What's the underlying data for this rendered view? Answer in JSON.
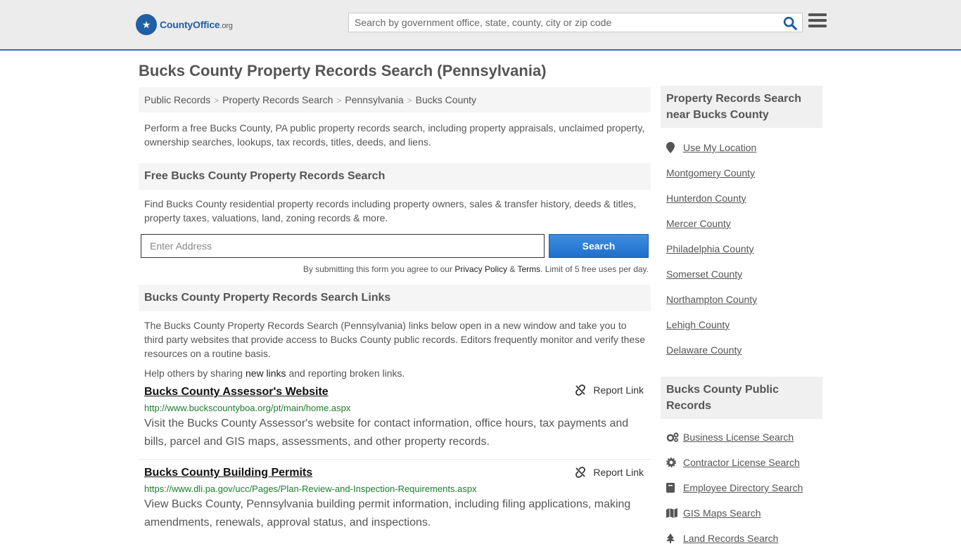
{
  "header": {
    "logo_name": "CountyOffice",
    "logo_tld": ".org",
    "search_placeholder": "Search by government office, state, county, city or zip code"
  },
  "page_title": "Bucks County Property Records Search (Pennsylvania)",
  "breadcrumb": [
    "Public Records",
    "Property Records Search",
    "Pennsylvania",
    "Bucks County"
  ],
  "intro": "Perform a free Bucks County, PA public property records search, including property appraisals, unclaimed property, ownership searches, lookups, tax records, titles, deeds, and liens.",
  "free_search": {
    "heading": "Free Bucks County Property Records Search",
    "text": "Find Bucks County residential property records including property owners, sales & transfer history, deeds & titles, property taxes, valuations, land, zoning records & more.",
    "address_placeholder": "Enter Address",
    "button": "Search",
    "disclaimer_prefix": "By submitting this form you agree to our ",
    "privacy": "Privacy Policy",
    "amp": " & ",
    "terms": "Terms",
    "disclaimer_suffix": ". Limit of 5 free uses per day."
  },
  "links_section": {
    "heading": "Bucks County Property Records Search Links",
    "text": "The Bucks County Property Records Search (Pennsylvania) links below open in a new window and take you to third party websites that provide access to Bucks County public records. Editors frequently monitor and verify these resources on a routine basis.",
    "help_prefix": "Help others by sharing ",
    "help_link": "new links",
    "help_suffix": " and reporting broken links.",
    "report_label": "Report Link",
    "entries": [
      {
        "title": "Bucks County Assessor's Website",
        "url": "http://www.buckscountyboa.org/pt/main/home.aspx",
        "desc": "Visit the Bucks County Assessor's website for contact information, office hours, tax payments and bills, parcel and GIS maps, assessments, and other property records."
      },
      {
        "title": "Bucks County Building Permits",
        "url": "https://www.dli.pa.gov/ucc/Pages/Plan-Review-and-Inspection-Requirements.aspx",
        "desc": "View Bucks County, Pennsylvania building permit information, including filing applications, making amendments, renewals, approval status, and inspections."
      }
    ]
  },
  "sidebar": {
    "nearby_heading": "Property Records Search near Bucks County",
    "use_location": "Use My Location",
    "nearby": [
      "Montgomery County",
      "Hunterdon County",
      "Mercer County",
      "Philadelphia County",
      "Somerset County",
      "Northampton County",
      "Lehigh County",
      "Delaware County"
    ],
    "public_heading": "Bucks County Public Records",
    "public_records": [
      {
        "label": "Business License Search",
        "icon": "gears-icon"
      },
      {
        "label": "Contractor License Search",
        "icon": "gear-icon"
      },
      {
        "label": "Employee Directory Search",
        "icon": "book-icon"
      },
      {
        "label": "GIS Maps Search",
        "icon": "map-icon"
      },
      {
        "label": "Land Records Search",
        "icon": "tree-icon"
      }
    ]
  },
  "colors": {
    "accent": "#2c6fb5",
    "url_green": "#1a7f2e",
    "button": "#1f6fcc"
  }
}
